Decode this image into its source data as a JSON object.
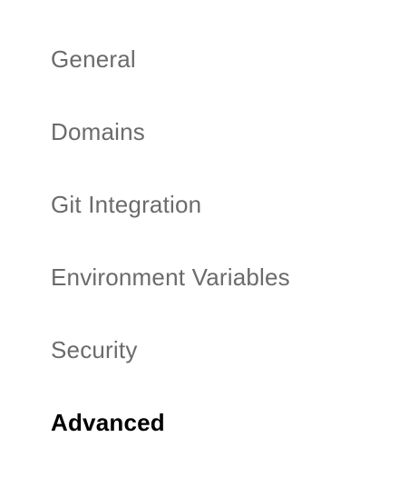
{
  "nav": {
    "items": [
      {
        "label": "General",
        "active": false
      },
      {
        "label": "Domains",
        "active": false
      },
      {
        "label": "Git Integration",
        "active": false
      },
      {
        "label": "Environment Variables",
        "active": false
      },
      {
        "label": "Security",
        "active": false
      },
      {
        "label": "Advanced",
        "active": true
      }
    ]
  },
  "colors": {
    "inactive_text": "#6b6b6b",
    "active_text": "#000000",
    "background": "#ffffff"
  }
}
